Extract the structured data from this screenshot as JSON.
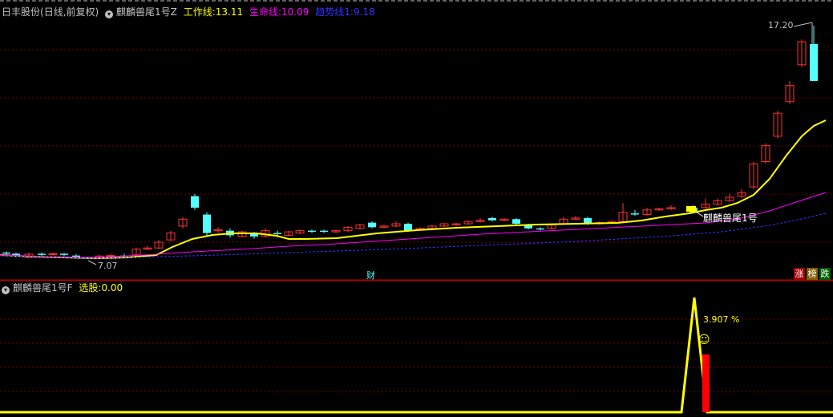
{
  "main_header": {
    "stock": "日丰股份",
    "mode": "(日线,前复权)",
    "indicator": "麒麟兽尾1号Z",
    "work_label": "工作线:",
    "work_value": "13.11",
    "life_label": "生命线:",
    "life_value": "10.09",
    "trend_label": "趋势线1:",
    "trend_value": "9.18"
  },
  "price_labels": {
    "high": "17.20",
    "low": "7.07"
  },
  "annotations": {
    "signal": "麒麟兽尾1号",
    "finance": "财"
  },
  "corner_buttons": {
    "up": "涨",
    "rank": "榜",
    "down": "跌"
  },
  "sub_header": {
    "indicator": "麒麟兽尾1号F",
    "select_label": "选股:",
    "select_value": "0.00"
  },
  "sub_annotation": {
    "percent": "3.907 %"
  },
  "colors": {
    "up": "#ff3232",
    "down": "#54ffff",
    "work": "#ffff00",
    "life": "#ff00ff",
    "trend": "#3333ff",
    "grid": "#800000",
    "text_white": "#c0c0c0"
  },
  "chart_data": [
    {
      "type": "candlestick",
      "title": "日丰股份",
      "series": [
        {
          "name": "工作线",
          "last": 13.11
        },
        {
          "name": "生命线",
          "last": 10.09
        },
        {
          "name": "趋势线1",
          "last": 9.18
        }
      ],
      "high": 17.2,
      "low": 7.07
    },
    {
      "type": "line",
      "title": "麒麟兽尾1号F",
      "series": [
        {
          "name": "选股",
          "last": 0.0
        }
      ],
      "peak_label": "3.907 %"
    }
  ]
}
